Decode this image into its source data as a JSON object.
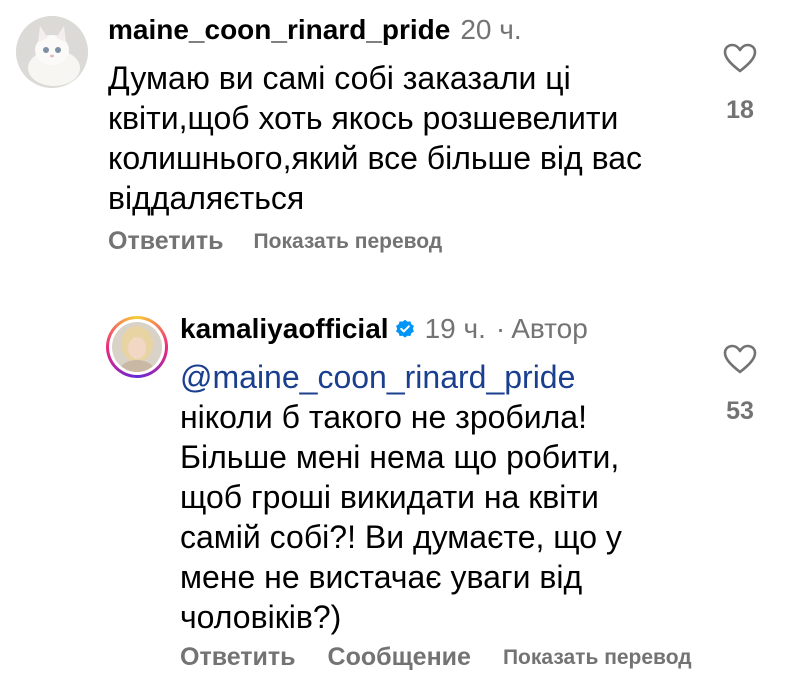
{
  "comments": [
    {
      "username": "maine_coon_rinard_pride",
      "time": "20 ч.",
      "text_lines": [
        "Думаю ви самі собі заказали ці",
        "квіти,щоб хоть якось розшевелити",
        "колишнього,який все більше від вас",
        "віддаляється"
      ],
      "likes": "18",
      "actions": {
        "reply": "Ответить",
        "translate": "Показать перевод"
      },
      "avatar_icon": "white-kitten-avatar"
    },
    {
      "username": "kamaliyaofficial",
      "verified": true,
      "time": "19 ч.",
      "separator": "·",
      "author_badge": "Автор",
      "mention": "@maine_coon_rinard_pride",
      "text_lines": [
        "ніколи б такого не зробила!",
        "Більше мені нема що робити,",
        "щоб гроші викидати на квіти",
        "самій собі?! Ви думаєте, що у",
        "мене не вистачає уваги від",
        "чоловіків?)"
      ],
      "likes": "53",
      "actions": {
        "reply": "Ответить",
        "message": "Сообщение",
        "translate": "Показать перевод"
      },
      "avatar_icon": "blonde-woman-avatar",
      "story_ring_colors": [
        "#f9ce34",
        "#ee2a7b",
        "#6228d7"
      ]
    }
  ],
  "colors": {
    "secondary_text": "#737373",
    "mention": "#1a3f8f",
    "verified": "#0095f6"
  }
}
